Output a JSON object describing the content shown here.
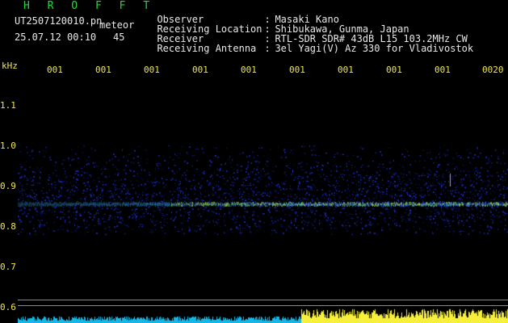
{
  "header": {
    "app_name": "H R O F F T",
    "filename": "UT2507120010.pn",
    "mode": "meteor",
    "datetime": "25.07.12 00:10",
    "seconds": "45",
    "rows": [
      {
        "key": "Observer",
        "value": "Masaki Kano"
      },
      {
        "key": "Receiving Location",
        "value": "Shibukawa, Gunma, Japan"
      },
      {
        "key": "Receiver",
        "value": "RTL-SDR SDR# 43dB L15 103.2MHz CW"
      },
      {
        "key": "Receiving Antenna",
        "value": "3el Yagi(V) Az 330 for Vladivostok"
      }
    ]
  },
  "y_axis": {
    "unit": "kHz",
    "ticks": [
      "1.1",
      "1.0",
      "0.9",
      "0.8",
      "0.7",
      "0.6"
    ]
  },
  "time_axis": {
    "labels": [
      "001",
      "001",
      "001",
      "001",
      "001",
      "001",
      "001",
      "001",
      "001",
      "0020"
    ]
  },
  "colors": {
    "background": "#000000",
    "title": "#27d63a",
    "labels": "#f0e84a",
    "text": "#e8e8e8",
    "signal_band": "#1e3cff",
    "meteor_echo": "#39d8ff",
    "carrier_line": "#b6ff3a",
    "power_low": "#16b6e6",
    "power_high": "#f6ef3b"
  }
}
